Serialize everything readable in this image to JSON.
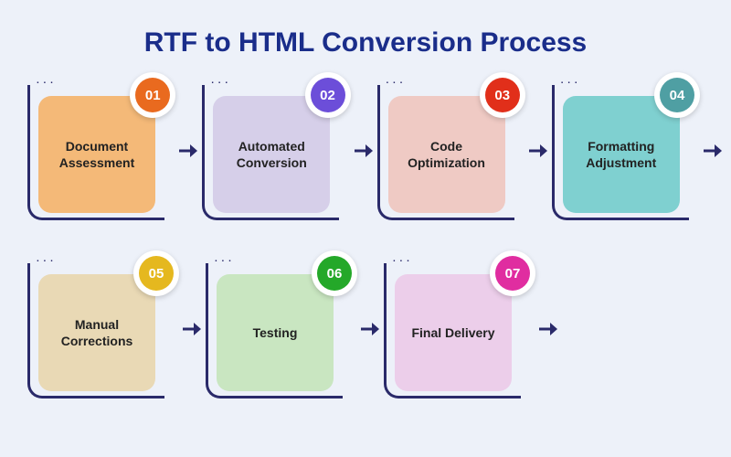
{
  "title": "RTF to HTML Conversion Process",
  "colors": {
    "frame": "#2a2a6a",
    "title": "#1a2d8a",
    "bg": "#edf1f9"
  },
  "steps": [
    {
      "num": "01",
      "label": "Document Assessment",
      "card": "#f4b978",
      "badge": "#e96a1f"
    },
    {
      "num": "02",
      "label": "Automated Conversion",
      "card": "#d6cfe9",
      "badge": "#6c4ed9"
    },
    {
      "num": "03",
      "label": "Code Optimization",
      "card": "#efcac4",
      "badge": "#e12f1a"
    },
    {
      "num": "04",
      "label": "Formatting Adjustment",
      "card": "#7fd0d0",
      "badge": "#4f9fa3"
    },
    {
      "num": "05",
      "label": "Manual Corrections",
      "card": "#e9d9b5",
      "badge": "#e5b81f"
    },
    {
      "num": "06",
      "label": "Testing",
      "card": "#c9e6c1",
      "badge": "#24a829"
    },
    {
      "num": "07",
      "label": "Final Delivery",
      "card": "#ecceea",
      "badge": "#e02da0"
    }
  ]
}
